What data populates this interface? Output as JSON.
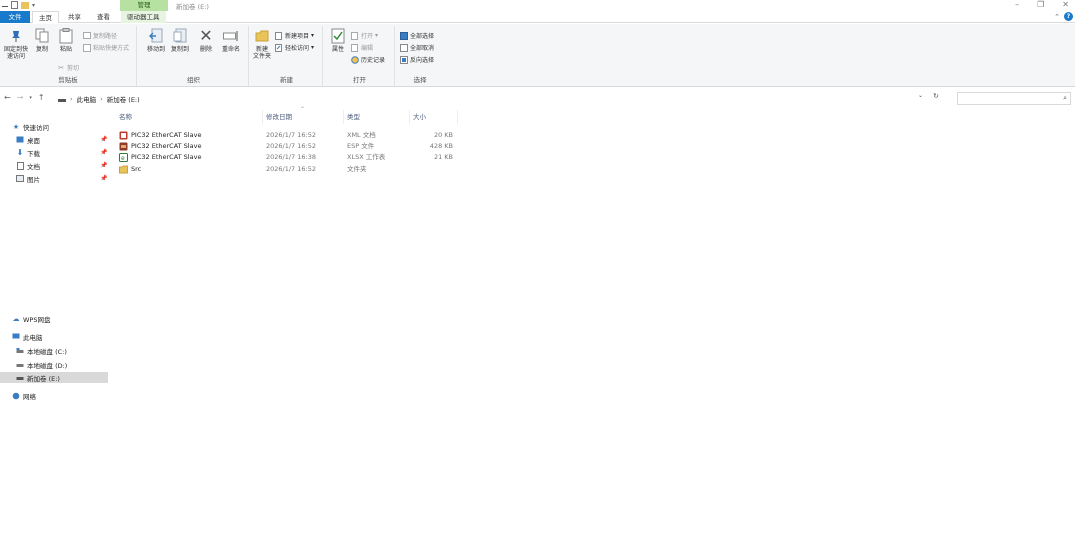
{
  "window": {
    "title": "新加卷 (E:)",
    "contextual_tab_head": "管理"
  },
  "tabs": {
    "file": "文件",
    "home": "主页",
    "share": "共享",
    "view": "查看",
    "drive_tools": "驱动器工具"
  },
  "ribbon": {
    "clipboard": {
      "label": "剪贴板",
      "pin_quick": "固定到快\n速访问",
      "copy": "复制",
      "paste": "粘贴",
      "copy_path": "复制路径",
      "paste_shortcut": "粘贴快捷方式",
      "cut": "剪切"
    },
    "organize": {
      "label": "组织",
      "move_to": "移动到",
      "copy_to": "复制到",
      "delete": "删除",
      "rename": "重命名"
    },
    "new": {
      "label": "新建",
      "new_folder": "新建\n文件夹",
      "new_item": "新建项目",
      "easy_access": "轻松访问"
    },
    "open": {
      "label": "打开",
      "properties": "属性",
      "open": "打开",
      "edit": "编辑",
      "history": "历史记录"
    },
    "select": {
      "label": "选择",
      "select_all": "全部选择",
      "select_none": "全部取消",
      "invert": "反向选择"
    }
  },
  "address": {
    "crumbs": [
      "此电脑",
      "新加卷 (E:)"
    ]
  },
  "navpane": {
    "quick_access": "快速访问",
    "desktop": "桌面",
    "downloads": "下载",
    "documents": "文档",
    "pictures": "图片",
    "wps": "WPS网盘",
    "this_pc": "此电脑",
    "drive_c": "本地磁盘 (C:)",
    "drive_d": "本地磁盘 (D:)",
    "drive_e": "新加卷 (E:)",
    "network": "网络"
  },
  "columns": {
    "name": "名称",
    "date": "修改日期",
    "type": "类型",
    "size": "大小"
  },
  "files": [
    {
      "name": "PIC32 EtherCAT Slave",
      "date": "2026/1/7 16:52",
      "type": "XML 文档",
      "size": "20 KB",
      "icon": "xml-file-icon",
      "color": "#c0392b"
    },
    {
      "name": "PIC32 EtherCAT Slave",
      "date": "2026/1/7 16:52",
      "type": "ESP 文件",
      "size": "428 KB",
      "icon": "esp-file-icon",
      "color": "#8e3b2b"
    },
    {
      "name": "PIC32 EtherCAT Slave",
      "date": "2026/1/7 16:38",
      "type": "XLSX 工作表",
      "size": "21 KB",
      "icon": "xlsx-file-icon",
      "color": "#2e7d32"
    },
    {
      "name": "Src",
      "date": "2026/1/7 16:52",
      "type": "文件夹",
      "size": "",
      "icon": "folder-icon",
      "color": "#e8c45a"
    }
  ]
}
